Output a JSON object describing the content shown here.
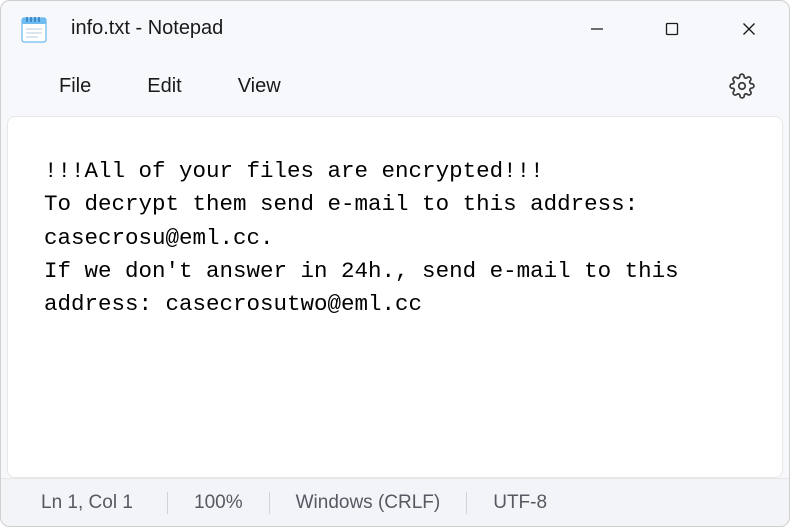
{
  "window": {
    "title": "info.txt - Notepad"
  },
  "menu": {
    "file": "File",
    "edit": "Edit",
    "view": "View"
  },
  "icons": {
    "notepad": "notepad-icon",
    "settings": "settings-gear-icon",
    "minimize": "minimize-icon",
    "maximize": "maximize-icon",
    "close": "close-icon"
  },
  "content": {
    "text": "!!!All of your files are encrypted!!!\nTo decrypt them send e-mail to this address: casecrosu@eml.cc.\nIf we don't answer in 24h., send e-mail to this address: casecrosutwo@eml.cc"
  },
  "status": {
    "cursor": "Ln 1, Col 1",
    "zoom": "100%",
    "lineEnding": "Windows (CRLF)",
    "encoding": "UTF-8"
  }
}
